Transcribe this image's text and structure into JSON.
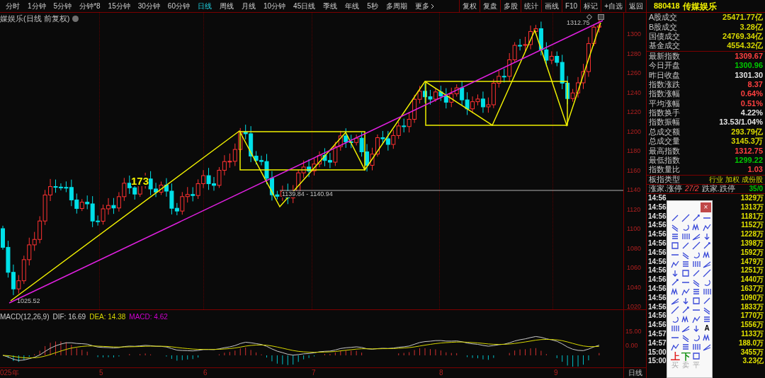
{
  "toolbar": {
    "periods": [
      {
        "label": "分时",
        "selected": false
      },
      {
        "label": "1分钟",
        "selected": false
      },
      {
        "label": "5分钟",
        "selected": false
      },
      {
        "label": "分钟*8",
        "selected": false
      },
      {
        "label": "15分钟",
        "selected": false
      },
      {
        "label": "30分钟",
        "selected": false
      },
      {
        "label": "60分钟",
        "selected": false
      },
      {
        "label": "日线",
        "selected": true
      },
      {
        "label": "周线",
        "selected": false
      },
      {
        "label": "月线",
        "selected": false
      },
      {
        "label": "10分钟",
        "selected": false
      },
      {
        "label": "45日线",
        "selected": false
      },
      {
        "label": "季线",
        "selected": false
      },
      {
        "label": "年线",
        "selected": false
      },
      {
        "label": "5秒",
        "selected": false
      },
      {
        "label": "多周期",
        "selected": false
      }
    ],
    "more": "更多",
    "buttons": [
      "复权",
      "复盘",
      "多股",
      "统计",
      "画线",
      "F10",
      "标记",
      "+自选",
      "返回"
    ]
  },
  "chart": {
    "title": "媒娱乐(日线 前复权)",
    "y_labels": [
      "1300",
      "1280",
      "1260",
      "1240",
      "1220",
      "1200",
      "1180",
      "1160",
      "1140",
      "1120",
      "1100",
      "1080",
      "1060",
      "1040",
      "1020"
    ],
    "annotations": [
      {
        "kind": "high",
        "text": "1312.75"
      },
      {
        "kind": "range",
        "text": "1139.84 - 1140.94"
      },
      {
        "kind": "low",
        "text": "1025.52"
      },
      {
        "kind": "note",
        "text": "173"
      }
    ]
  },
  "macd": {
    "indicator": "MACD(12,26,9)",
    "items": [
      {
        "label": "DIF: 16.69",
        "color": "#d0d0d0"
      },
      {
        "label": "DEA: 14.38",
        "color": "#d8d800"
      },
      {
        "label": "MACD: 4.62",
        "color": "#d000d0"
      }
    ],
    "y_labels": [
      "15.00",
      "0.00"
    ]
  },
  "x_axis": {
    "labels": [
      "025年",
      "5",
      "6",
      "7",
      "8",
      "9"
    ],
    "period": "日线"
  },
  "panel": {
    "code": "880418",
    "name": "传媒娱乐",
    "stats": [
      {
        "label": "A股成交",
        "value": "25471.77亿",
        "color": "#d8d800"
      },
      {
        "label": "B股成交",
        "value": "3.28亿",
        "color": "#d8d800"
      },
      {
        "label": "国债成交",
        "value": "24769.34亿",
        "color": "#d8d800"
      },
      {
        "label": "基金成交",
        "value": "4554.32亿",
        "color": "#d8d800"
      },
      {
        "label": "最新指数",
        "value": "1309.67",
        "color": "#ff4040"
      },
      {
        "label": "今日开盘",
        "value": "1300.96",
        "color": "#00c800"
      },
      {
        "label": "昨日收盘",
        "value": "1301.30",
        "color": "#e0e0e0"
      },
      {
        "label": "指数涨跌",
        "value": "8.37",
        "color": "#ff4040"
      },
      {
        "label": "指数涨幅",
        "value": "0.64%",
        "color": "#ff4040"
      },
      {
        "label": "平均涨幅",
        "value": "0.51%",
        "color": "#ff4040"
      },
      {
        "label": "指数换手",
        "value": "4.22%",
        "color": "#e0e0e0"
      },
      {
        "label": "指数振幅",
        "value": "13.53/1.04%",
        "color": "#e0e0e0"
      },
      {
        "label": "总成交额",
        "value": "293.79亿",
        "color": "#d8d800"
      },
      {
        "label": "总成交量",
        "value": "3145.3万",
        "color": "#d8d800"
      },
      {
        "label": "最高指数",
        "value": "1312.75",
        "color": "#ff4040"
      },
      {
        "label": "最低指数",
        "value": "1299.22",
        "color": "#00c800"
      },
      {
        "label": "指数量比",
        "value": "1.03",
        "color": "#ff4040"
      }
    ],
    "type_label": "板指类型",
    "type_value": "行业 加权 成份股",
    "rise_label": "涨家.涨停",
    "rise_value": "27/2",
    "fall_label": "跌家.跌停",
    "fall_value": "35/0",
    "ticks": [
      {
        "time": "14:56",
        "volume": "1329万"
      },
      {
        "time": "14:56",
        "volume": "1313万"
      },
      {
        "time": "14:56",
        "volume": "1181万"
      },
      {
        "time": "14:56",
        "volume": "1152万"
      },
      {
        "time": "14:56",
        "volume": "1228万"
      },
      {
        "time": "14:56",
        "volume": "1398万"
      },
      {
        "time": "14:56",
        "volume": "1592万"
      },
      {
        "time": "14:56",
        "volume": "1479万"
      },
      {
        "time": "14:56",
        "volume": "1251万"
      },
      {
        "time": "14:56",
        "volume": "1440万"
      },
      {
        "time": "14:56",
        "volume": "1637万"
      },
      {
        "time": "14:56",
        "volume": "1090万"
      },
      {
        "time": "14:56",
        "volume": "1833万"
      },
      {
        "time": "14:56",
        "volume": "1770万"
      },
      {
        "time": "14:56",
        "volume": "1556万"
      },
      {
        "time": "14:57",
        "volume": "1133万"
      },
      {
        "time": "14:57",
        "volume": "188.0万"
      },
      {
        "time": "15:00",
        "volume": "3455万"
      },
      {
        "time": "15:00",
        "volume": "3.23亿"
      }
    ]
  },
  "palette": {
    "close": "×",
    "letter_tool": "A",
    "order_tools": [
      {
        "label": "上",
        "color": "#e02020"
      },
      {
        "label": "下",
        "color": "#109010"
      }
    ],
    "trade_tools": [
      {
        "label": "买",
        "disabled": true
      },
      {
        "label": "卖",
        "disabled": true
      },
      {
        "label": "平",
        "disabled": true
      }
    ]
  }
}
